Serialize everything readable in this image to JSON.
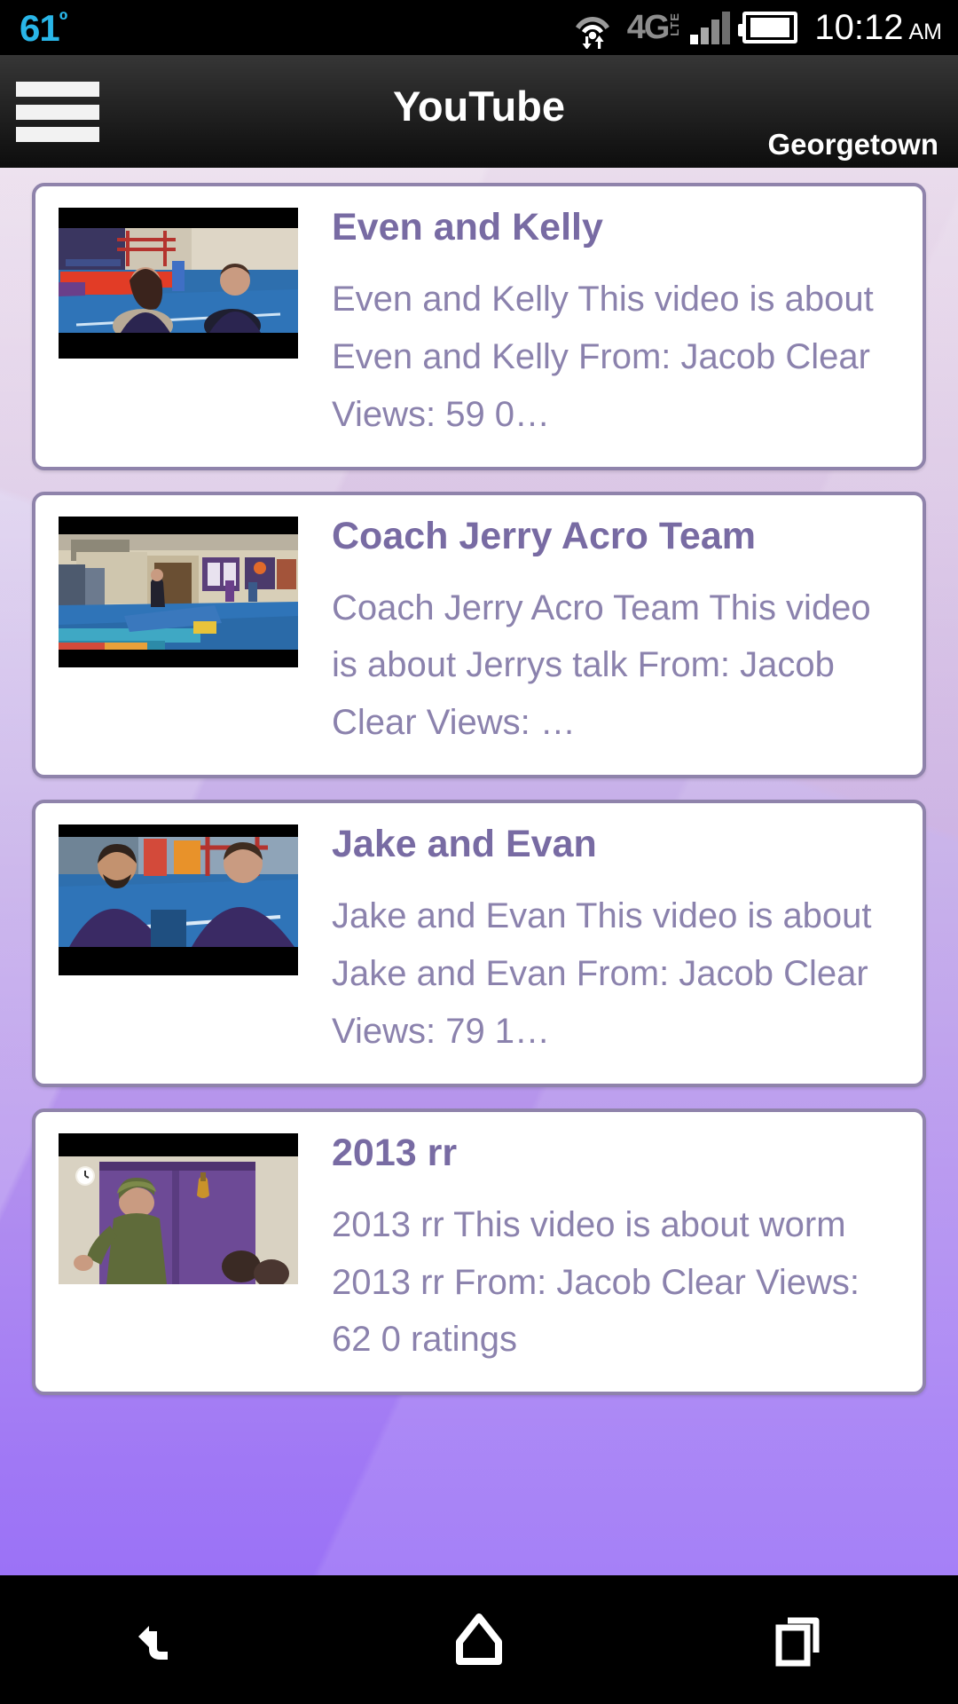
{
  "status_bar": {
    "temperature": "61",
    "degree_symbol": "º",
    "network_type": "4G",
    "network_sub": "LTE",
    "time": "10:12",
    "meridiem": "AM",
    "icons": [
      "wifi-icon",
      "data-transfer-icon",
      "signal-bars-icon",
      "battery-icon"
    ],
    "accent_color": "#29b6e8"
  },
  "header": {
    "menu_label": "menu",
    "title": "YouTube",
    "account": "Georgetown"
  },
  "theme": {
    "card_border": "#8f83ab",
    "title_color": "#786ba3",
    "desc_color": "#8b82ad",
    "bg_top": "#efeaf6",
    "bg_bottom": "#9b72f6"
  },
  "videos": [
    {
      "title": "Even and Kelly",
      "description": "Even and Kelly This video is about Even and Kelly From: Jacob Clear Views: 59 0…",
      "thumbnail": "even-and-kelly-thumbnail"
    },
    {
      "title": "Coach Jerry Acro Team",
      "description": "Coach Jerry Acro Team This video is about Jerrys talk From: Jacob Clear Views: …",
      "thumbnail": "coach-jerry-acro-team-thumbnail"
    },
    {
      "title": "Jake and Evan",
      "description": "Jake and Evan This video is about Jake and Evan From: Jacob Clear Views: 79 1…",
      "thumbnail": "jake-and-evan-thumbnail"
    },
    {
      "title": "2013 rr",
      "description": "2013 rr This video is about worm 2013 rr From: Jacob Clear Views: 62 0 ratings",
      "thumbnail": "2013-rr-thumbnail"
    }
  ],
  "nav_bar": {
    "back_label": "Back",
    "home_label": "Home",
    "recents_label": "Recent apps"
  }
}
